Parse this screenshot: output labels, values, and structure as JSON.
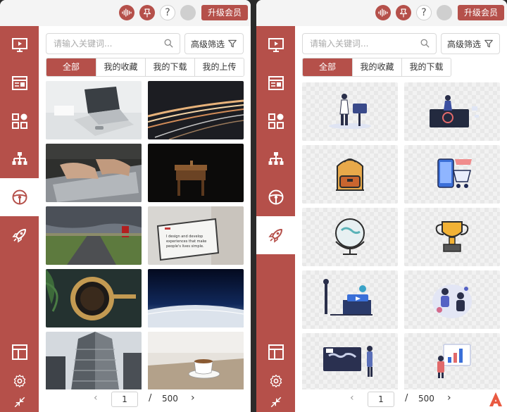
{
  "topbar": {
    "upgrade_label": "升级会员",
    "help_glyph": "?",
    "icons": [
      "waveform-icon",
      "pin-icon",
      "help-icon",
      "avatar"
    ]
  },
  "sidebar": {
    "items": [
      {
        "name": "slideshow-icon"
      },
      {
        "name": "article-icon"
      },
      {
        "name": "components-icon"
      },
      {
        "name": "hierarchy-icon"
      },
      {
        "name": "steering-wheel-icon"
      },
      {
        "name": "rocket-icon"
      }
    ],
    "bottom": [
      {
        "name": "layout-icon"
      },
      {
        "name": "gear-icon"
      },
      {
        "name": "collapse-icon"
      }
    ]
  },
  "left_panel": {
    "search_placeholder": "请输入关键词...",
    "filter_label": "高级筛选",
    "tabs": [
      "全部",
      "我的收藏",
      "我的下载",
      "我的上传"
    ],
    "active_tab": 0,
    "tile_caption": "I design and develop experiences that make people's lives simple.",
    "pager": {
      "current": "1",
      "slash": "/",
      "total": "500",
      "prev": "‹",
      "next": "›"
    }
  },
  "right_panel": {
    "search_placeholder": "请输入关键词...",
    "filter_label": "高级筛选",
    "tabs": [
      "全部",
      "我的收藏",
      "我的下载"
    ],
    "active_tab": 0,
    "pager": {
      "current": "1",
      "slash": "/",
      "total": "500",
      "prev": "‹",
      "next": "›"
    }
  },
  "colors": {
    "accent": "#b5504a",
    "active_bg": "#ffffff",
    "topbar_bg": "#f4f4f4"
  }
}
